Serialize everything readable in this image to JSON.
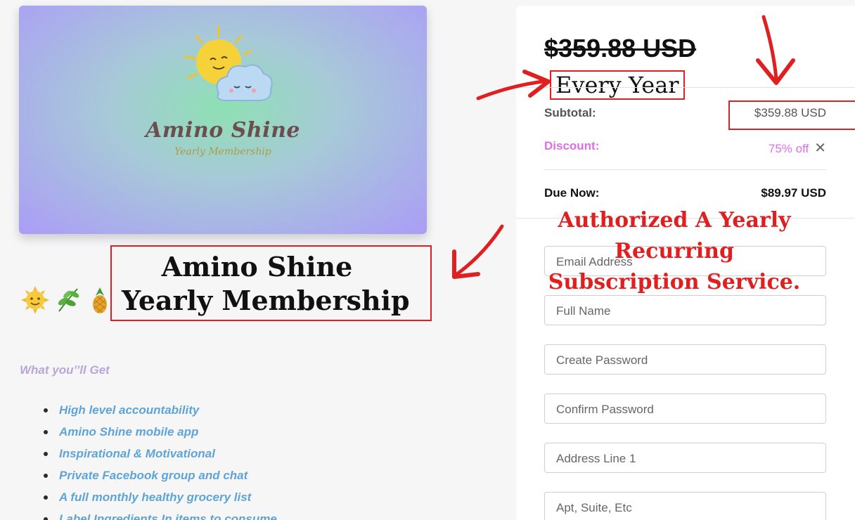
{
  "product": {
    "card_brand": "Amino Shine",
    "card_subtitle": "Yearly Membership",
    "title_line1": "Amino Shine",
    "title_line2": "Yearly Membership",
    "emojis": [
      "sun-with-face",
      "herb",
      "pineapple"
    ]
  },
  "features": {
    "heading": "What you’’ll Get",
    "items": [
      "High level accountability",
      "Amino Shine mobile app",
      "Inspirational & Motivational",
      "Private Facebook group and chat",
      "A full monthly healthy grocery list",
      "Label Ingredients In items to consume"
    ]
  },
  "checkout": {
    "original_price": "$359.88 USD",
    "billing_period": "Every Year",
    "subtotal_label": "Subtotal:",
    "subtotal_value": "$359.88 USD",
    "discount_label": "Discount:",
    "discount_value": "75% off",
    "remove_symbol": "✕",
    "due_label": "Due Now:",
    "due_value": "$89.97 USD"
  },
  "annotation": {
    "line1": "Authorized A Yearly Recurring",
    "line2": "Subscription Service."
  },
  "form": {
    "email_placeholder": "Email Address",
    "fullname_placeholder": "Full Name",
    "password_placeholder": "Create Password",
    "confirm_placeholder": "Confirm Password",
    "address1_placeholder": "Address Line 1",
    "address2_placeholder": "Apt, Suite, Etc"
  },
  "colors": {
    "annotation_red": "#e02020",
    "discount_pink": "#dd6fe6",
    "feature_blue": "#5fa4d6",
    "heading_lavender": "#b6a6dc"
  }
}
